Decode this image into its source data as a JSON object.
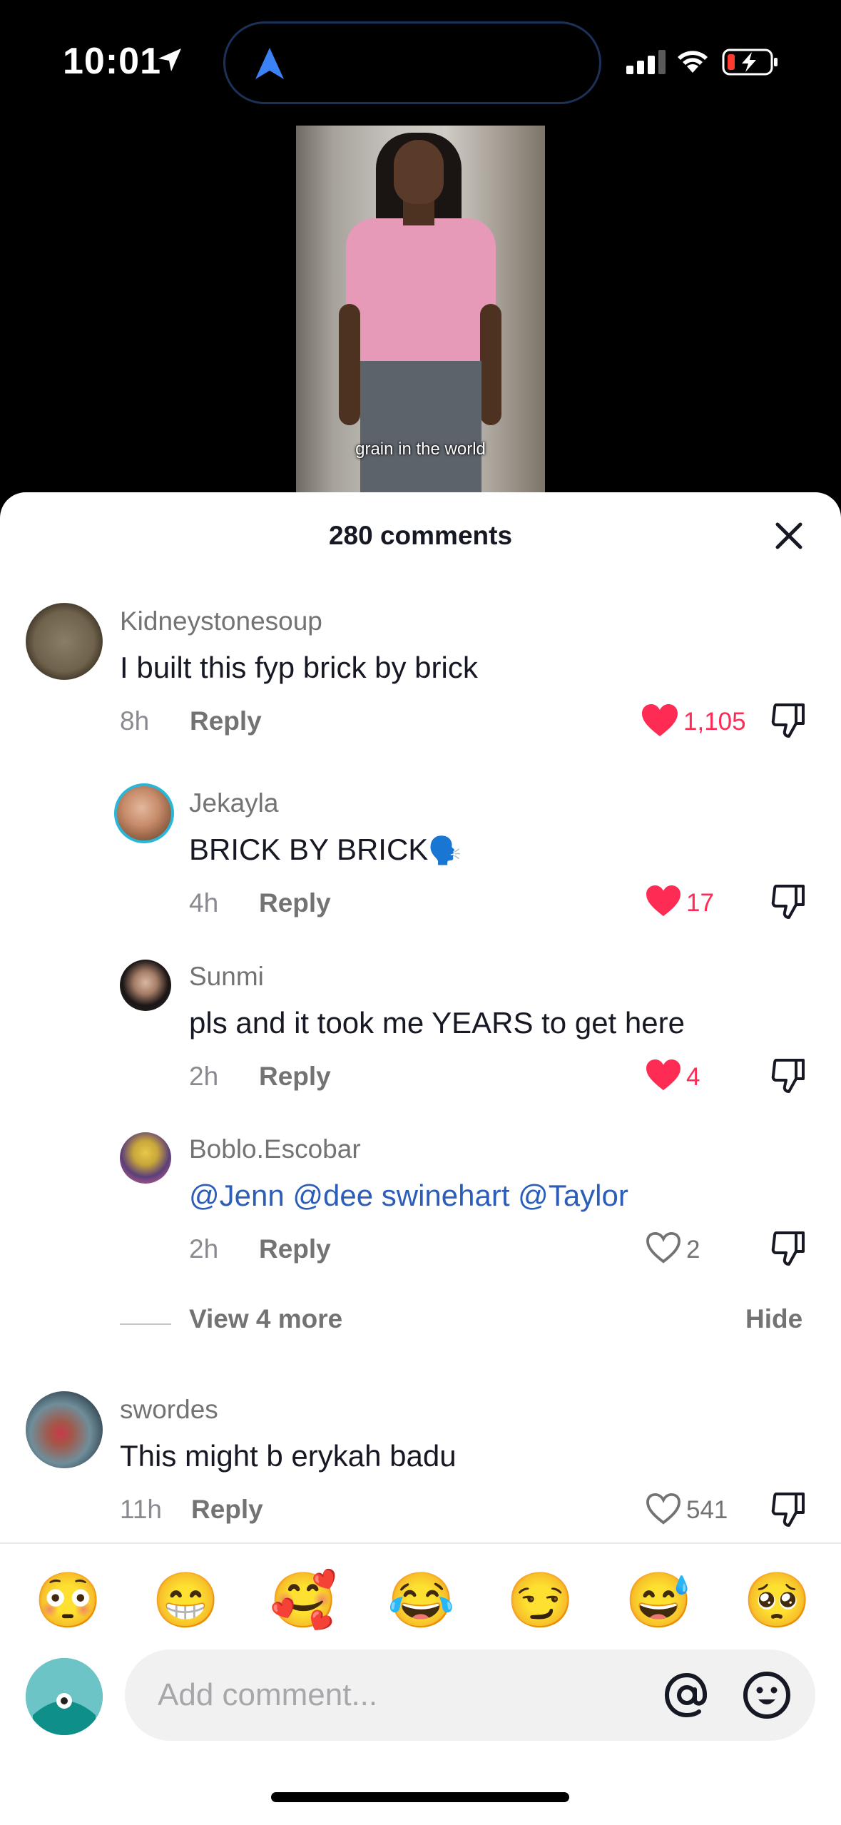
{
  "status_bar": {
    "time": "10:01"
  },
  "video": {
    "caption": "grain in the world"
  },
  "sheet": {
    "title": "280 comments"
  },
  "comments": [
    {
      "username": "Kidneystonesoup",
      "text": "I built this fyp brick by brick",
      "age": "8h",
      "reply": "Reply",
      "likes": "1,105",
      "liked": true
    },
    {
      "username": "Jekayla",
      "text": "BRICK BY BRICK",
      "age": "4h",
      "reply": "Reply",
      "likes": "17",
      "liked": true,
      "emoji": "🗣️"
    },
    {
      "username": "Sunmi",
      "text": "pls and it took me YEARS to get here",
      "age": "2h",
      "reply": "Reply",
      "likes": "4",
      "liked": true
    },
    {
      "username": "Boblo.Escobar",
      "text": "@Jenn @dee swinehart @Taylor",
      "age": "2h",
      "reply": "Reply",
      "likes": "2",
      "liked": false
    },
    {
      "username": "swordes",
      "text": "This might b erykah badu",
      "age": "11h",
      "reply": "Reply",
      "likes": "541",
      "liked": false
    }
  ],
  "thread": {
    "view_more": "View 4 more",
    "hide": "Hide"
  },
  "emoji_bar": [
    "😳",
    "😁",
    "🥰",
    "😂",
    "😏",
    "😅",
    "🥺"
  ],
  "composer": {
    "placeholder": "Add comment..."
  },
  "colors": {
    "like_red": "#fe2c55",
    "mention_blue": "#2b5db9",
    "island_border": "#1c3158",
    "nav_arrow": "#3b82f6"
  }
}
